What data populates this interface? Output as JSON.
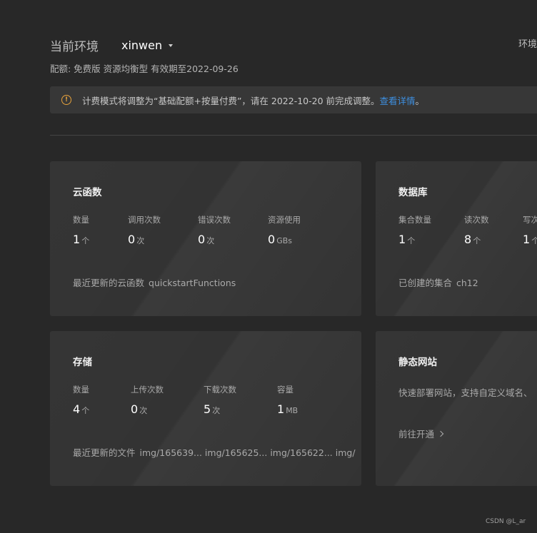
{
  "header": {
    "env_label": "当前环境",
    "env_name": "xinwen",
    "settings_label": "环境"
  },
  "quota": "配额: 免费版 资源均衡型 有效期至2022-09-26",
  "notice": {
    "text": "计费模式将调整为“基础配额+按量付费”，请在 2022-10-20 前完成调整。",
    "link": "查看详情",
    "tail": "。"
  },
  "cards": {
    "functions": {
      "title": "云函数",
      "stats": [
        {
          "label": "数量",
          "value": "1",
          "unit": "个"
        },
        {
          "label": "调用次数",
          "value": "0",
          "unit": "次"
        },
        {
          "label": "错误次数",
          "value": "0",
          "unit": "次"
        },
        {
          "label": "资源使用",
          "value": "0",
          "unit": "GBs"
        }
      ],
      "foot_label": "最近更新的云函数",
      "foot_value": "quickstartFunctions"
    },
    "database": {
      "title": "数据库",
      "stats": [
        {
          "label": "集合数量",
          "value": "1",
          "unit": "个"
        },
        {
          "label": "读次数",
          "value": "8",
          "unit": "个"
        },
        {
          "label": "写次",
          "value": "1",
          "unit": "个"
        }
      ],
      "foot_label": "已创建的集合",
      "foot_value": "ch12"
    },
    "storage": {
      "title": "存储",
      "stats": [
        {
          "label": "数量",
          "value": "4",
          "unit": "个"
        },
        {
          "label": "上传次数",
          "value": "0",
          "unit": "次"
        },
        {
          "label": "下载次数",
          "value": "5",
          "unit": "次"
        },
        {
          "label": "容量",
          "value": "1",
          "unit": "MB"
        }
      ],
      "foot_label": "最近更新的文件",
      "foot_value": "img/165639...  img/165625...  img/165622...  img/"
    },
    "hosting": {
      "title": "静态网站",
      "desc": "快速部署网站，支持自定义域名、",
      "link": "前往开通"
    }
  },
  "watermark": "CSDN @L_ar",
  "colors": {
    "background": "#282828",
    "card": "#333333",
    "link": "#3d8fe0",
    "warning": "#e6a23c"
  }
}
